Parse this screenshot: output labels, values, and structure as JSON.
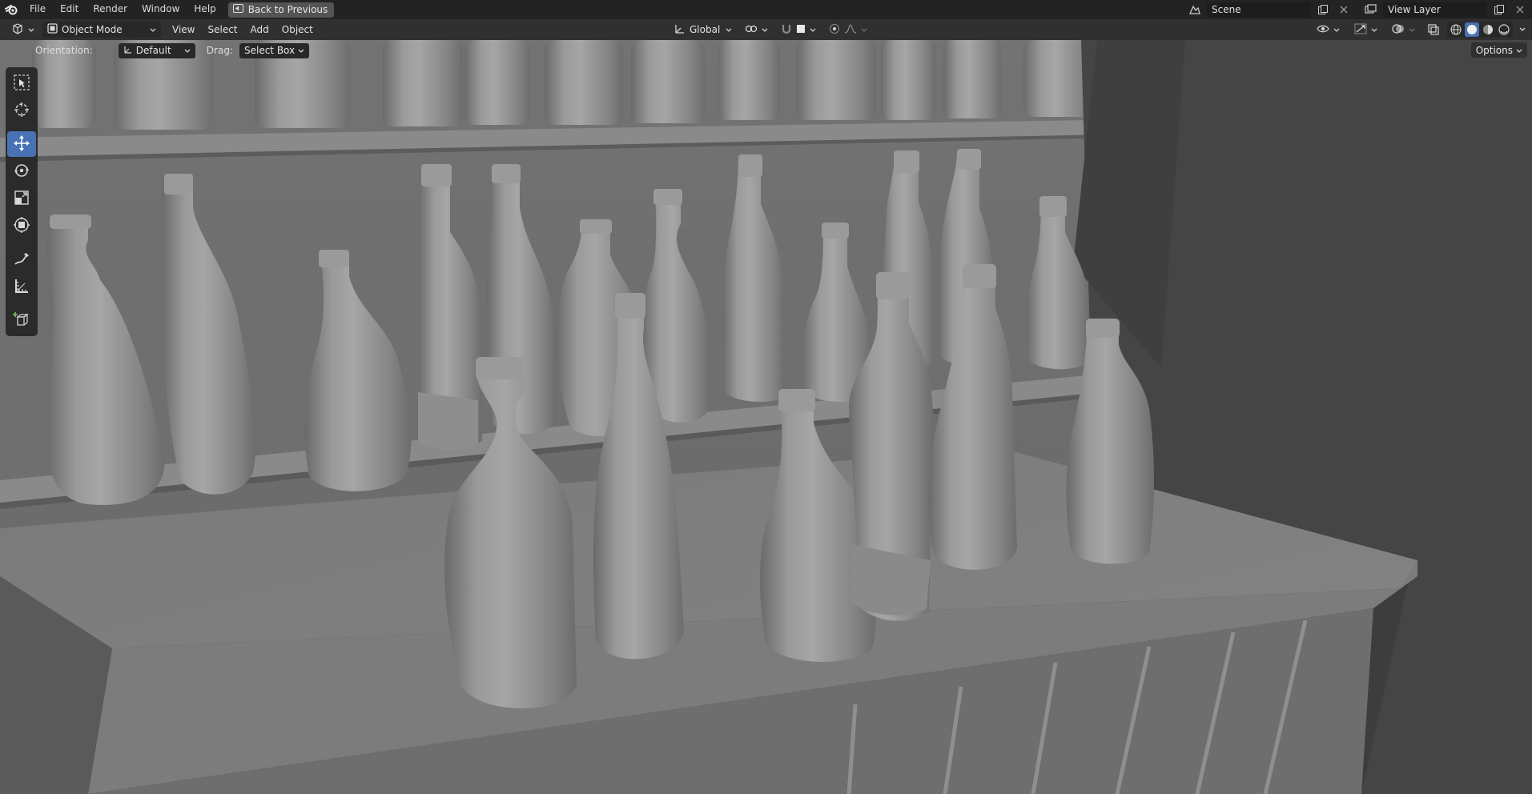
{
  "menubar": {
    "items": [
      "File",
      "Edit",
      "Render",
      "Window",
      "Help"
    ],
    "back_button": "Back to Previous",
    "scene": "Scene",
    "view_layer": "View Layer"
  },
  "header": {
    "mode": "Object Mode",
    "menus": [
      "View",
      "Select",
      "Add",
      "Object"
    ],
    "transform_orientation": "Global"
  },
  "tool_options": {
    "orientation_label": "Orientation:",
    "orientation_value": "Default",
    "drag_label": "Drag:",
    "drag_value": "Select Box",
    "options_button": "Options"
  },
  "toolbar": {
    "tools": [
      "select-box",
      "cursor",
      "move",
      "rotate",
      "scale",
      "transform",
      "annotate",
      "measure",
      "add-cube"
    ],
    "active": "move"
  },
  "colors": {
    "accent": "#4772b3",
    "topbar": "#232323",
    "header": "#303030",
    "viewport_bg": "#3d3d3d"
  }
}
